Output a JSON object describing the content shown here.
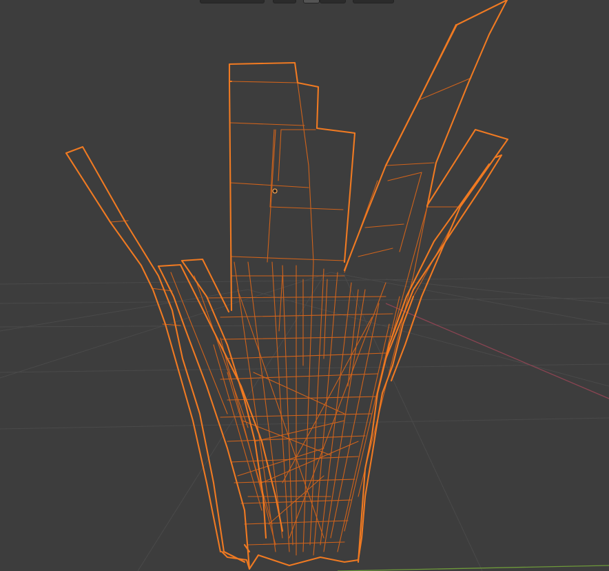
{
  "viewport": {
    "mode": "wireframe",
    "background": "#3d3d3d",
    "selection_color": "#f07a22",
    "wire_color": "#e26c1c",
    "grid_color": "#4a4a4a",
    "x_axis_color": "#8a4452",
    "y_axis_color": "#6e9a3a"
  },
  "object": {
    "type": "grass tuft mesh",
    "selected": true
  },
  "header_buttons": [
    {
      "name": "view-menu",
      "active": false
    },
    {
      "name": "shading-solid",
      "active": false
    },
    {
      "name": "shading-material",
      "active": true
    },
    {
      "name": "shading-rendered",
      "active": false
    },
    {
      "name": "shading-wire",
      "active": false
    }
  ]
}
